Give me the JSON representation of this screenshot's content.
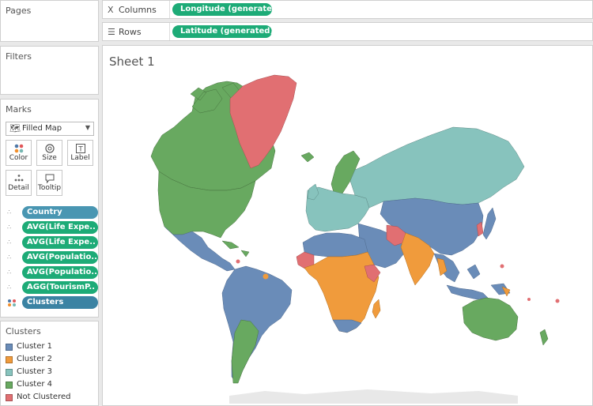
{
  "pages_panel": {
    "title": "Pages"
  },
  "filters_panel": {
    "title": "Filters"
  },
  "columns_shelf": {
    "label": "Columns",
    "icon": "columns-icon",
    "pill": "Longitude (generated)"
  },
  "rows_shelf": {
    "label": "Rows",
    "icon": "rows-icon",
    "pill": "Latitude (generated)"
  },
  "sheet": {
    "title": "Sheet 1"
  },
  "marks": {
    "title": "Marks",
    "mark_type": "Filled Map",
    "buttons": [
      {
        "label": "Color",
        "icon": "color-dots-icon"
      },
      {
        "label": "Size",
        "icon": "size-icon"
      },
      {
        "label": "Label",
        "icon": "label-icon"
      },
      {
        "label": "Detail",
        "icon": "detail-icon"
      },
      {
        "label": "Tooltip",
        "icon": "tooltip-icon"
      }
    ],
    "fields": [
      {
        "label": "Country",
        "role": "detail",
        "color": "#4996b2"
      },
      {
        "label": "AVG(Life Expe..",
        "role": "detail",
        "color": "#1dab77"
      },
      {
        "label": "AVG(Life Expe..",
        "role": "detail",
        "color": "#1dab77"
      },
      {
        "label": "AVG(Populatio..",
        "role": "detail",
        "color": "#1dab77"
      },
      {
        "label": "AVG(Populatio..",
        "role": "detail",
        "color": "#1dab77"
      },
      {
        "label": "AGG(TourismP..",
        "role": "detail",
        "color": "#1dab77"
      },
      {
        "label": "Clusters",
        "role": "color",
        "color": "#3b83a3"
      }
    ]
  },
  "legend": {
    "title": "Clusters",
    "items": [
      {
        "label": "Cluster 1",
        "color": "#6a8cb8"
      },
      {
        "label": "Cluster 2",
        "color": "#f09b3c"
      },
      {
        "label": "Cluster 3",
        "color": "#87c3bd"
      },
      {
        "label": "Cluster 4",
        "color": "#68a960"
      },
      {
        "label": "Not Clustered",
        "color": "#e16f72"
      }
    ]
  }
}
